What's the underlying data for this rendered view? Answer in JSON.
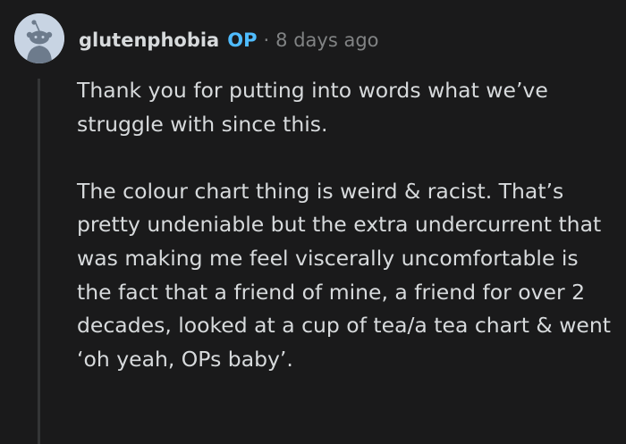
{
  "comment": {
    "username": "glutenphobia",
    "op_badge": "OP",
    "separator": "·",
    "timestamp": "8 days ago",
    "paragraphs": [
      "Thank you for putting into words what we’ve struggle with since this.",
      "The colour chart thing is weird & racist. That’s pretty undeniable but the extra undercurrent that was making me feel viscerally uncomfortable is the fact that a friend of mine, a friend for over 2 decades, looked at a cup of tea/a tea chart & went ‘oh yeah, OPs baby’."
    ]
  },
  "icons": {
    "avatar": "snoo-avatar-icon"
  },
  "colors": {
    "background": "#1a1a1b",
    "text": "#d7dadc",
    "muted": "#818384",
    "op_badge": "#4fbcff",
    "thread_line": "#343536",
    "avatar_bg": "#c8d4e3"
  }
}
